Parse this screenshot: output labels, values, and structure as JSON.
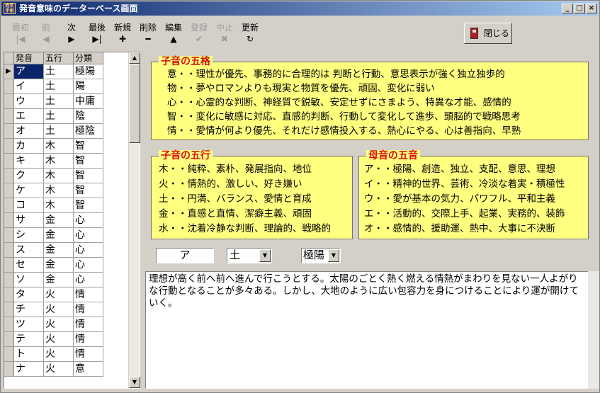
{
  "window": {
    "title": "発音意味のデーターベース画面",
    "app_icon_text": "姓名手相",
    "controls": {
      "minimize": "_",
      "maximize": "□",
      "close": "×"
    }
  },
  "toolbar": {
    "first": {
      "label": "最初",
      "icon": "first-record-icon",
      "glyph": "|◀"
    },
    "prev": {
      "label": "前",
      "icon": "prev-record-icon",
      "glyph": "◀"
    },
    "next": {
      "label": "次",
      "icon": "next-record-icon",
      "glyph": "▶"
    },
    "last": {
      "label": "最後",
      "icon": "last-record-icon",
      "glyph": "▶|"
    },
    "new": {
      "label": "新規",
      "icon": "plus-icon",
      "glyph": "✚"
    },
    "delete": {
      "label": "削除",
      "icon": "minus-icon",
      "glyph": "━"
    },
    "edit": {
      "label": "編集",
      "icon": "edit-triangle-icon",
      "glyph": "▲"
    },
    "post": {
      "label": "登録",
      "icon": "check-icon",
      "glyph": "✔"
    },
    "cancel": {
      "label": "中止",
      "icon": "x-icon",
      "glyph": "✖"
    },
    "refresh": {
      "label": "更新",
      "icon": "refresh-icon",
      "glyph": "↻"
    },
    "close": {
      "label": "閉じる",
      "icon": "door-exit-icon"
    }
  },
  "grid": {
    "columns": [
      "発音",
      "五行",
      "分類"
    ],
    "current_indicator": "▶",
    "rows": [
      [
        "ア",
        "土",
        "極陽"
      ],
      [
        "イ",
        "土",
        "陽"
      ],
      [
        "ウ",
        "土",
        "中庸"
      ],
      [
        "エ",
        "土",
        "陰"
      ],
      [
        "オ",
        "土",
        "極陰"
      ],
      [
        "カ",
        "木",
        "智"
      ],
      [
        "キ",
        "木",
        "智"
      ],
      [
        "ク",
        "木",
        "智"
      ],
      [
        "ケ",
        "木",
        "智"
      ],
      [
        "コ",
        "木",
        "智"
      ],
      [
        "サ",
        "金",
        "心"
      ],
      [
        "シ",
        "金",
        "心"
      ],
      [
        "ス",
        "金",
        "心"
      ],
      [
        "セ",
        "金",
        "心"
      ],
      [
        "ソ",
        "金",
        "心"
      ],
      [
        "タ",
        "火",
        "情"
      ],
      [
        "チ",
        "火",
        "情"
      ],
      [
        "ツ",
        "火",
        "情"
      ],
      [
        "テ",
        "火",
        "情"
      ],
      [
        "ト",
        "火",
        "情"
      ],
      [
        "ナ",
        "火",
        "意"
      ]
    ]
  },
  "five_types": {
    "title": "子音の五格",
    "lines": [
      "意・・理性が優先、事務的に合理的は 判断と行動、意思表示が強く独立独歩的",
      "物・・夢やロマンよりも現実と物質を優先、頑固、変化に弱い",
      "心・・心霊的な判断、神経質で鋭敏、安定せずにさまよう、特異な才能、感情的",
      "智・・変化に敏感に対応、直感的判断、行動して変化して進歩、頭脳的で戦略思考",
      "情・・愛情が何より優先、それだけ感情投入する、熱心にやる、心は善指向、早熟"
    ]
  },
  "consonant_elements": {
    "title": "子音の五行",
    "lines": [
      "木・・純粋、素朴、発展指向、地位",
      "火・・情熱的、激しい、好き嫌い",
      "土・・円満、バランス、愛情と育成",
      "金・・直感と直情、潔癖主義、頑固",
      "水・・沈着冷静な判断、理論的、戦略的"
    ]
  },
  "vowel_types": {
    "title": "母音の五音",
    "lines": [
      "ア・・極陽、創造、独立、支配、意思、理想",
      "イ・・精神的世界、芸術、冷淡な着実・積極性",
      "ウ・・愛が基本の気力、パワフル、平和主義",
      "エ・・活動的、交際上手、起業、実務的、装飾",
      "オ・・感情的、援助運、熱中、大事に不決断"
    ]
  },
  "detail": {
    "sound": "ア",
    "element": "土",
    "category": "極陽",
    "description": "理想が高く前へ前へ進んで行こうとする。太陽のごとく熱く燃える情熱がまわりを見ない一人よがりな行動となることが多々ある。しかし、大地のように広い包容力を身につけることにより運が開けていく。"
  },
  "colors": {
    "titlebar_start": "#0a246a",
    "titlebar_end": "#a6caf0",
    "panel_bg": "#ffff80",
    "panel_title": "#d81010",
    "selection": "#0a246a",
    "face": "#d4d0c8"
  }
}
